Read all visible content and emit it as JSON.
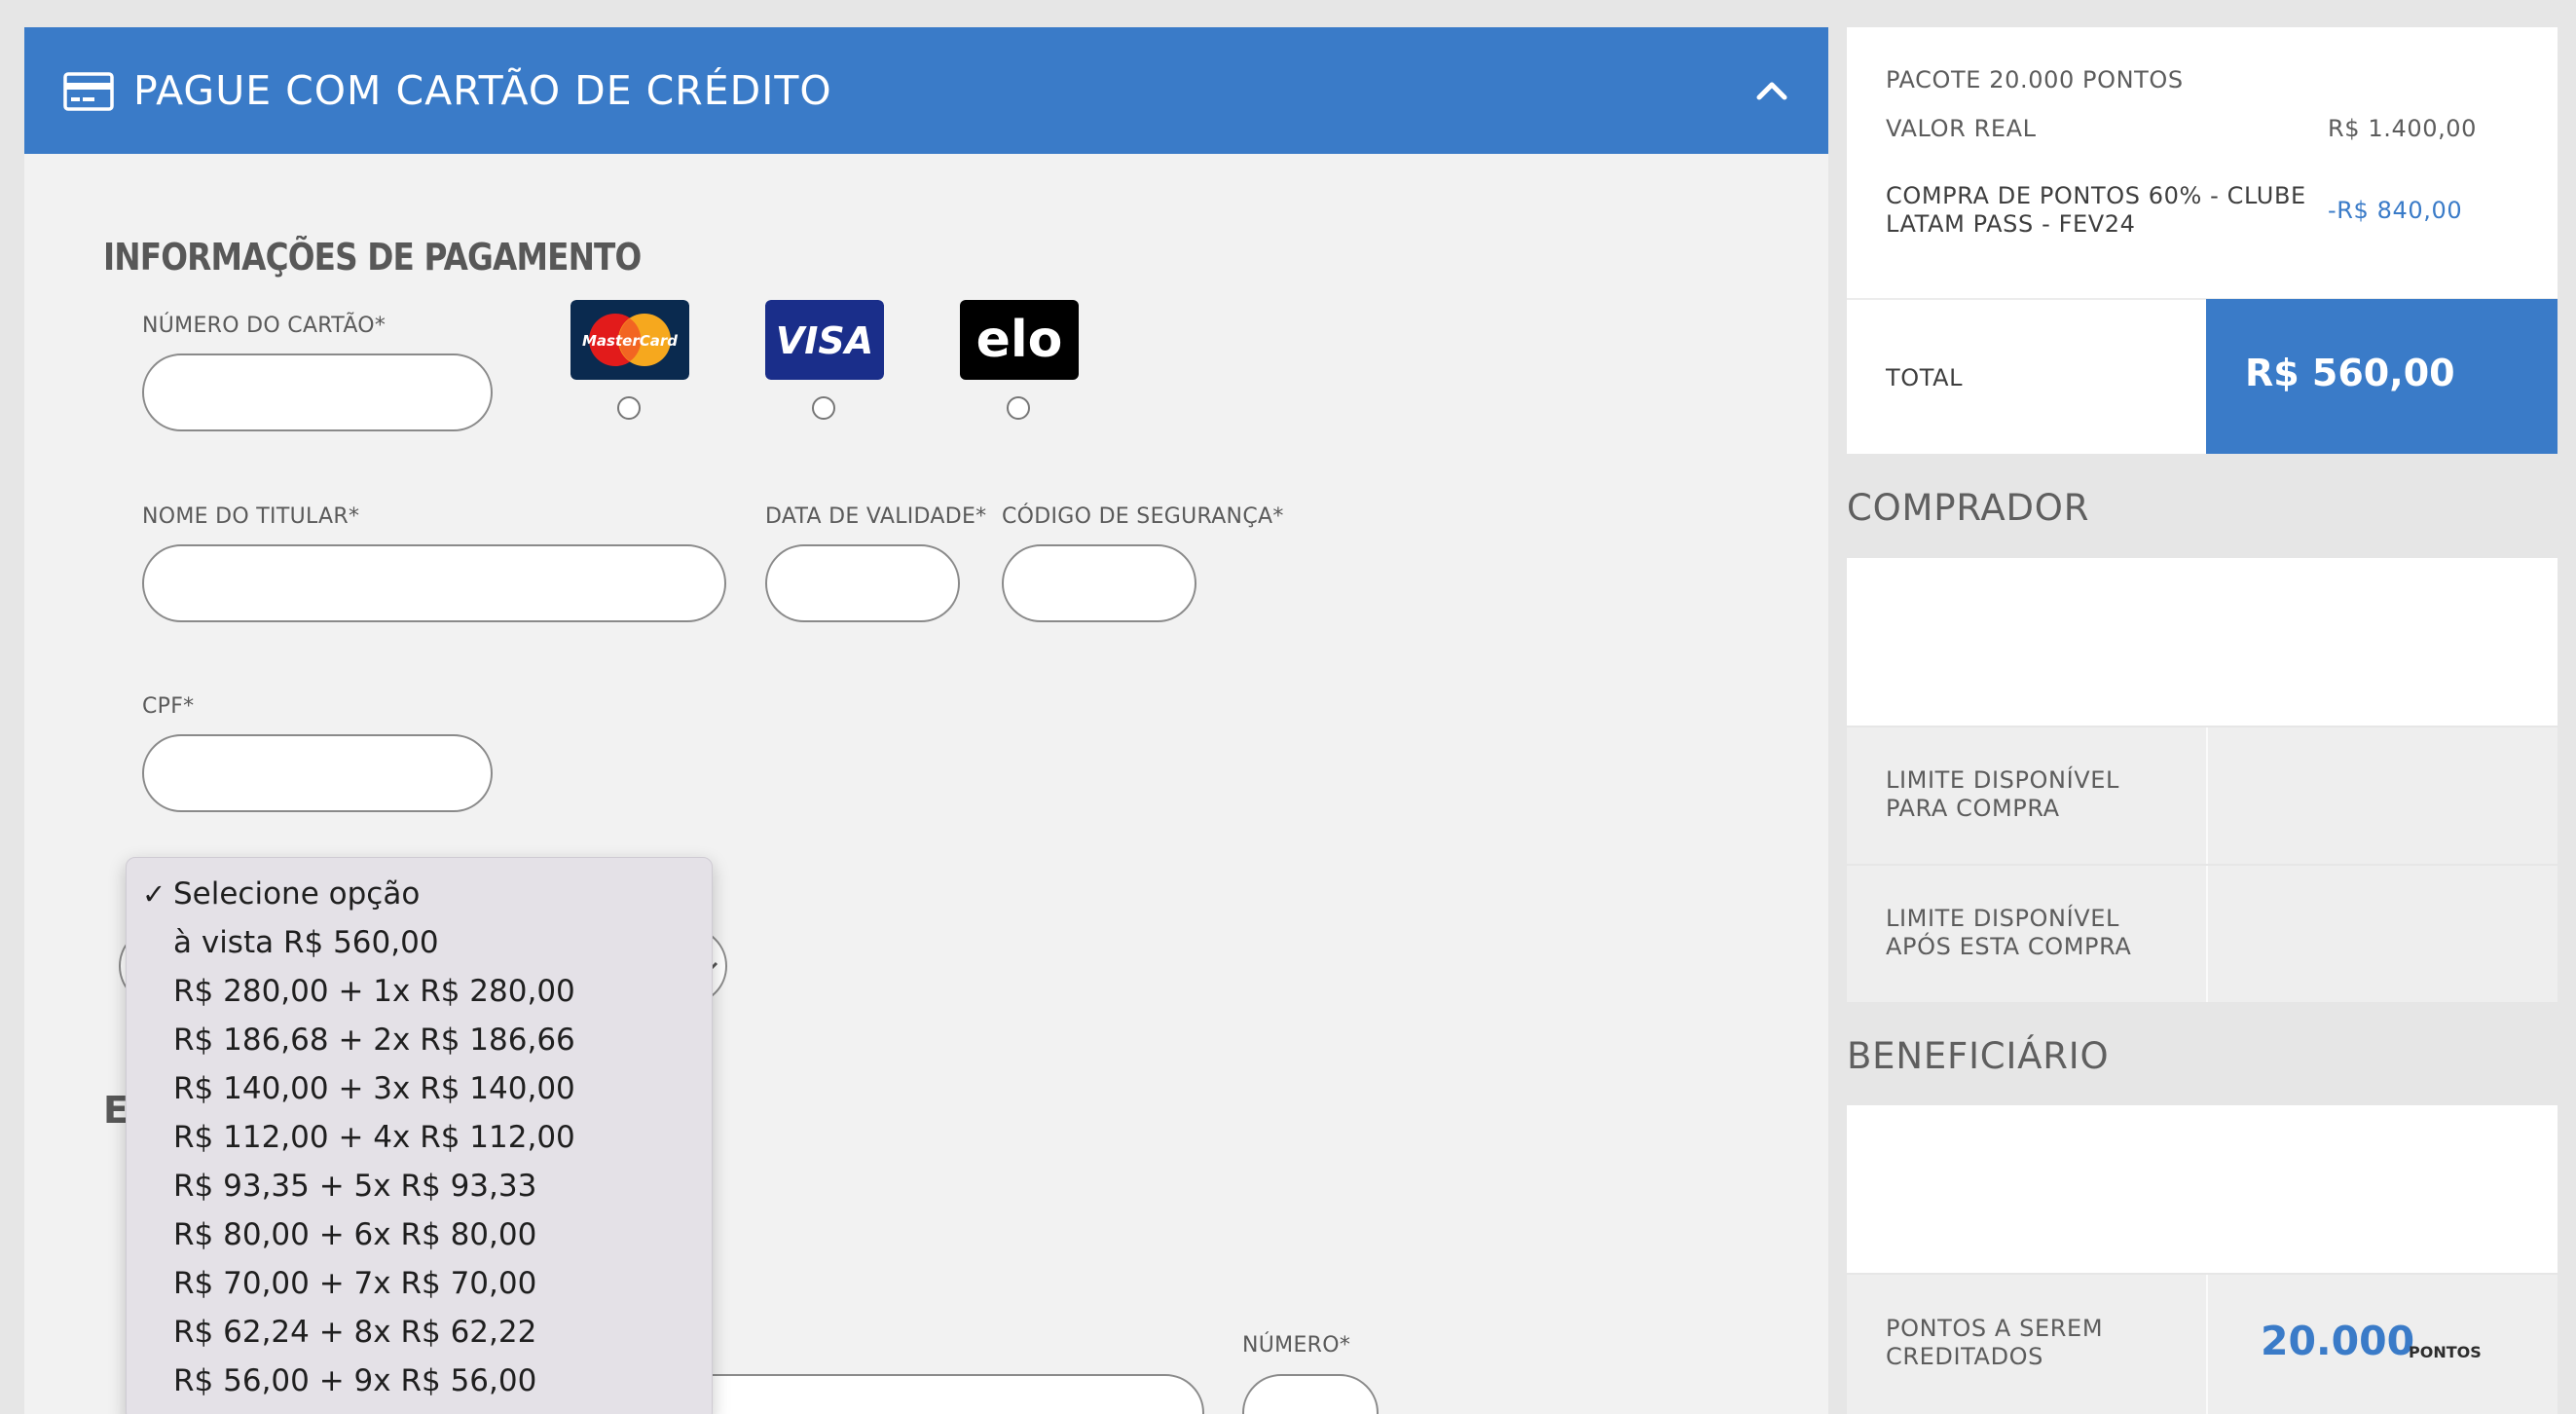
{
  "payment_header": {
    "title": "PAGUE COM CARTÃO DE CRÉDITO",
    "icon": "credit-card-icon",
    "collapse_icon": "chevron-up-icon",
    "color": "#3a7bc8"
  },
  "payment_info": {
    "title": "INFORMAÇÕES DE PAGAMENTO",
    "card_number_label": "NÚMERO DO CARTÃO*",
    "card_number_value": "",
    "brands": [
      {
        "name": "MasterCard",
        "icon": "mastercard-icon",
        "selected": false
      },
      {
        "name": "VISA",
        "icon": "visa-icon",
        "selected": false
      },
      {
        "name": "elo",
        "icon": "elo-icon",
        "selected": false
      }
    ],
    "holder_label": "NOME DO TITULAR*",
    "holder_value": "",
    "expiry_label": "DATA DE VALIDADE*",
    "expiry_value": "",
    "cvv_label": "CÓDIGO DE SEGURANÇA*",
    "cvv_value": "",
    "cpf_label": "CPF*",
    "cpf_value": ""
  },
  "installments": {
    "selected": "Selecione opção",
    "options": [
      "Selecione opção",
      "à vista R$ 560,00",
      "R$ 280,00 + 1x R$ 280,00",
      "R$ 186,68 + 2x R$ 186,66",
      "R$ 140,00 + 3x R$ 140,00",
      "R$ 112,00 + 4x R$ 112,00",
      "R$ 93,35 + 5x R$ 93,33",
      "R$ 80,00 + 6x R$ 80,00",
      "R$ 70,00 + 7x R$ 70,00",
      "R$ 62,24 + 8x R$ 62,22",
      "R$ 56,00 + 9x R$ 56,00"
    ]
  },
  "address": {
    "section_letter": "E",
    "number_label": "NÚMERO*"
  },
  "summary": {
    "package": "PACOTE 20.000 PONTOS",
    "real_value_label": "VALOR REAL",
    "real_value": "R$ 1.400,00",
    "discount_label_line1": "COMPRA DE PONTOS 60% - CLUBE",
    "discount_label_line2": "LATAM PASS - FEV24",
    "discount_value": "-R$ 840,00",
    "total_label": "TOTAL",
    "total_value": "R$ 560,00"
  },
  "buyer": {
    "title": "COMPRADOR",
    "limit_label_line1": "LIMITE DISPONÍVEL",
    "limit_label_line2": "PARA COMPRA",
    "limit_after_line1": "LIMITE DISPONÍVEL",
    "limit_after_line2": "APÓS ESTA COMPRA"
  },
  "beneficiary": {
    "title": "BENEFICIÁRIO",
    "points_label_line1": "PONTOS A SEREM",
    "points_label_line2": "CREDITADOS",
    "points_value": "20.000",
    "points_unit": "PONTOS"
  }
}
